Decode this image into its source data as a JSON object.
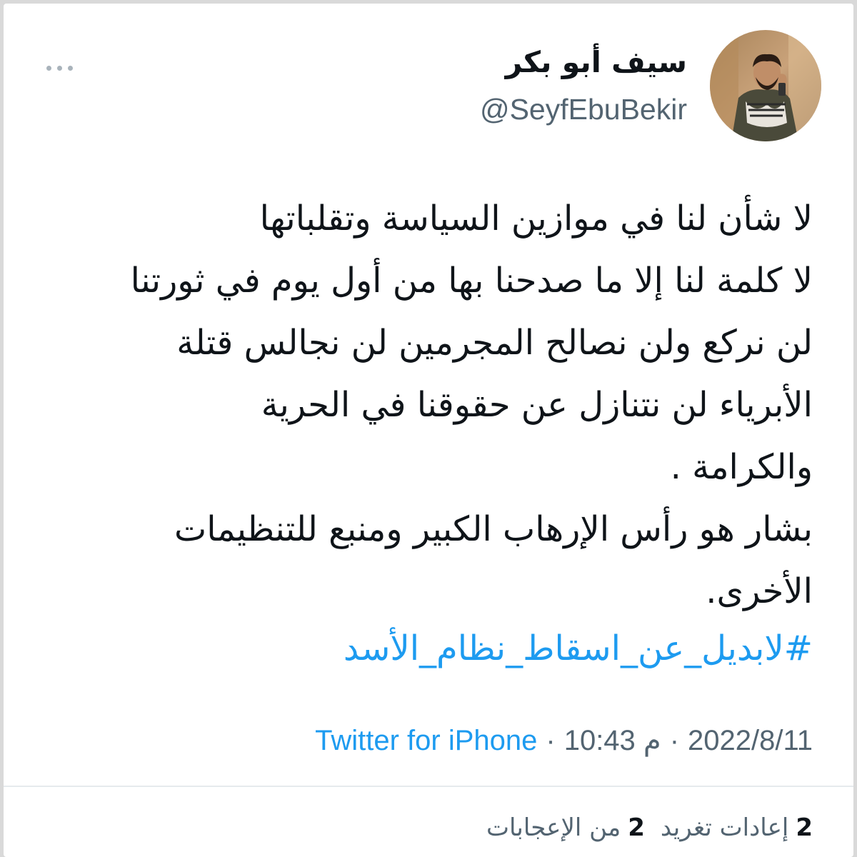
{
  "author": {
    "display_name": "سيف أبو بكر",
    "handle": "@SeyfEbuBekir",
    "avatar_icon": "person-photo-avatar"
  },
  "more_icon": "more-horizontal-icon",
  "tweet": {
    "lines": [
      "لا شأن لنا في موازين السياسة وتقلباتها",
      "لا كلمة لنا إلا ما صدحنا بها من أول يوم في ثورتنا",
      "لن نركع ولن نصالح المجرمين لن نجالس قتلة",
      "الأبرياء لن نتنازل عن حقوقنا في الحرية",
      "والكرامة .",
      "بشار هو رأس الإرهاب الكبير ومنبع للتنظيمات",
      "الأخرى."
    ],
    "hashtag": "#لابديل_عن_اسقاط_نظام_الأسد"
  },
  "meta": {
    "date": "2022/8/11",
    "separator": "·",
    "time": "10:43 م",
    "source": "Twitter for iPhone"
  },
  "stats": {
    "retweets_count": "2",
    "retweets_label": "إعادات تغريد",
    "likes_count": "2",
    "likes_label": "من الإعجابات"
  },
  "colors": {
    "link_blue": "#1d9bf0",
    "text_primary": "#0f1419",
    "text_secondary": "#536471"
  }
}
